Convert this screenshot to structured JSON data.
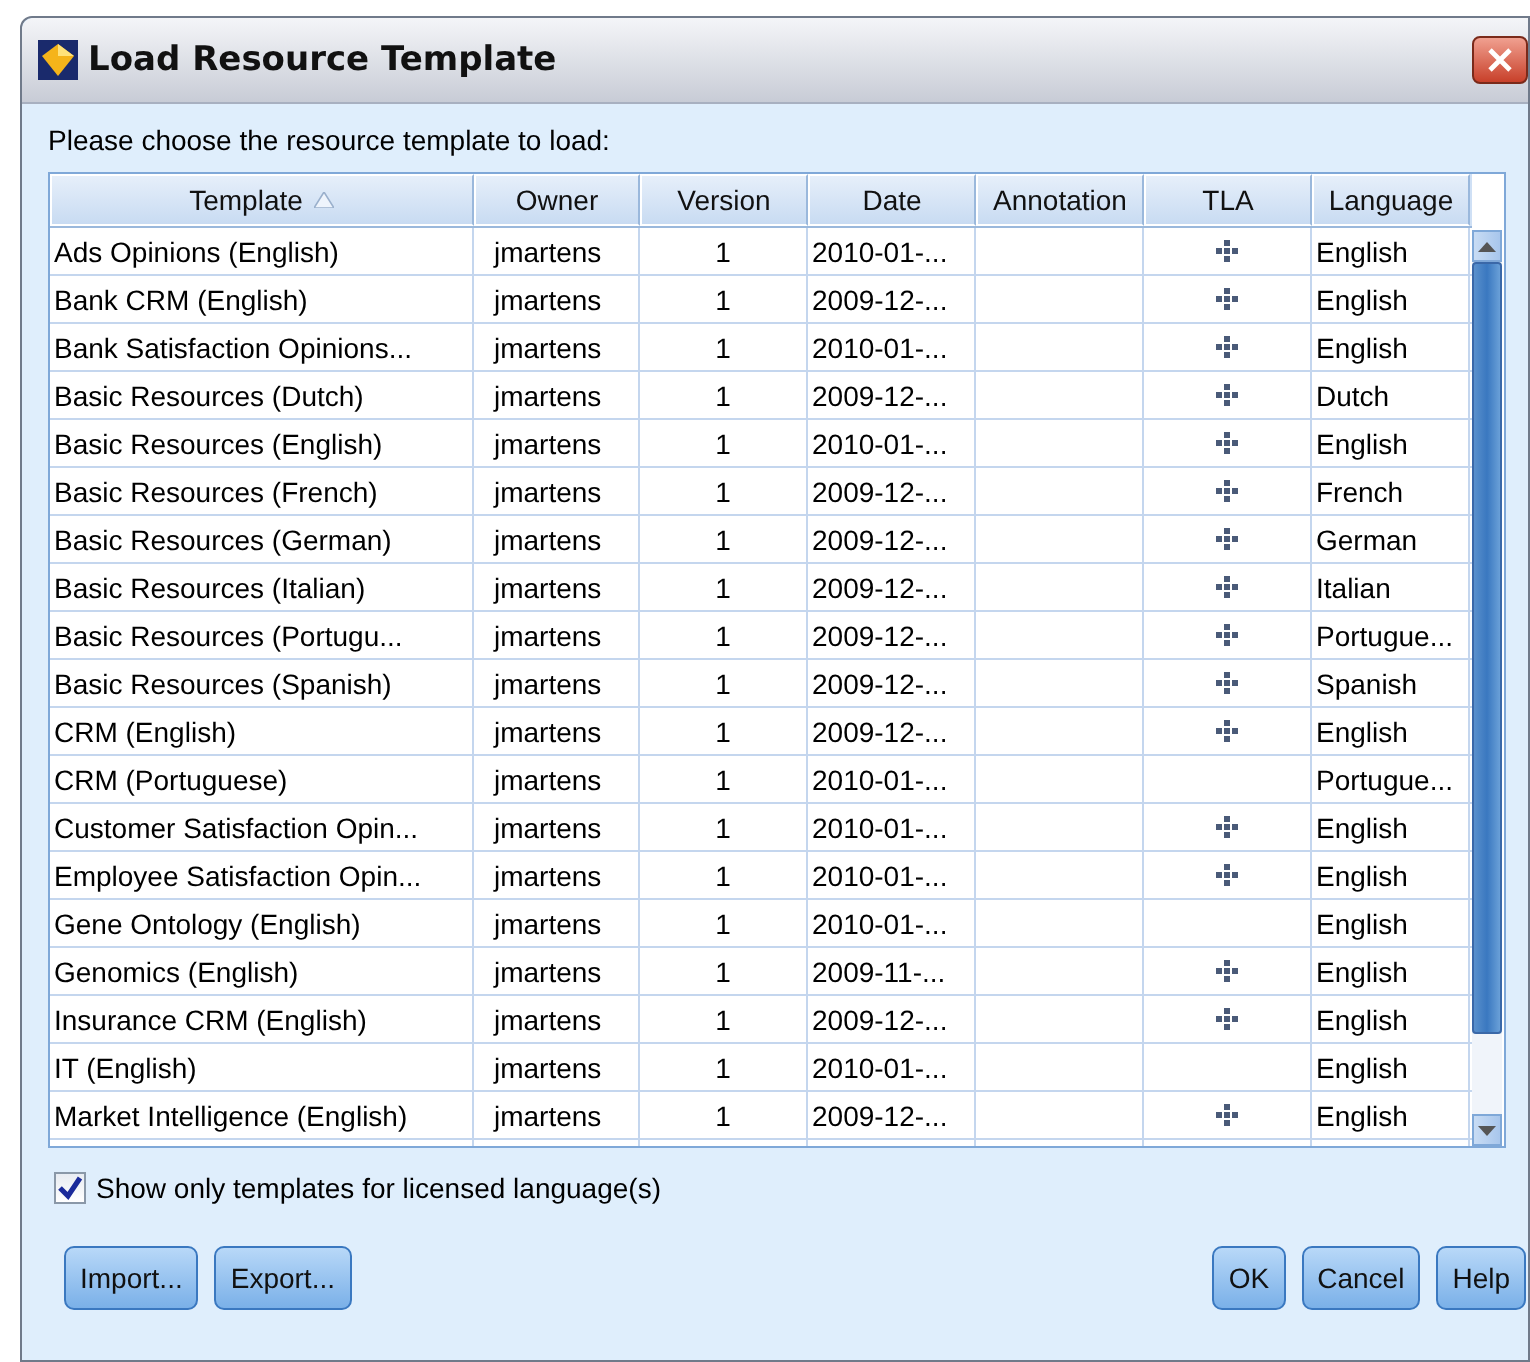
{
  "window": {
    "title": "Load Resource Template"
  },
  "prompt": "Please choose the resource template to load:",
  "table": {
    "columns": [
      {
        "label": "Template",
        "sorted": true
      },
      {
        "label": "Owner",
        "sorted": false
      },
      {
        "label": "Version",
        "sorted": false
      },
      {
        "label": "Date",
        "sorted": false
      },
      {
        "label": "Annotation",
        "sorted": false
      },
      {
        "label": "TLA",
        "sorted": false
      },
      {
        "label": "Language",
        "sorted": false
      }
    ],
    "rows": [
      {
        "template": "Ads Opinions (English)",
        "owner": "jmartens",
        "version": "1",
        "date": "2010-01-...",
        "tla": true,
        "language": "English"
      },
      {
        "template": "Bank CRM (English)",
        "owner": "jmartens",
        "version": "1",
        "date": "2009-12-...",
        "tla": true,
        "language": "English"
      },
      {
        "template": "Bank Satisfaction Opinions...",
        "owner": "jmartens",
        "version": "1",
        "date": "2010-01-...",
        "tla": true,
        "language": "English"
      },
      {
        "template": "Basic Resources (Dutch)",
        "owner": "jmartens",
        "version": "1",
        "date": "2009-12-...",
        "tla": true,
        "language": "Dutch"
      },
      {
        "template": "Basic Resources (English)",
        "owner": "jmartens",
        "version": "1",
        "date": "2010-01-...",
        "tla": true,
        "language": "English"
      },
      {
        "template": "Basic Resources (French)",
        "owner": "jmartens",
        "version": "1",
        "date": "2009-12-...",
        "tla": true,
        "language": "French"
      },
      {
        "template": "Basic Resources (German)",
        "owner": "jmartens",
        "version": "1",
        "date": "2009-12-...",
        "tla": true,
        "language": "German"
      },
      {
        "template": "Basic Resources (Italian)",
        "owner": "jmartens",
        "version": "1",
        "date": "2009-12-...",
        "tla": true,
        "language": "Italian"
      },
      {
        "template": "Basic Resources (Portugu...",
        "owner": "jmartens",
        "version": "1",
        "date": "2009-12-...",
        "tla": true,
        "language": "Portugue..."
      },
      {
        "template": "Basic Resources (Spanish)",
        "owner": "jmartens",
        "version": "1",
        "date": "2009-12-...",
        "tla": true,
        "language": "Spanish"
      },
      {
        "template": "CRM (English)",
        "owner": "jmartens",
        "version": "1",
        "date": "2009-12-...",
        "tla": true,
        "language": "English"
      },
      {
        "template": "CRM (Portuguese)",
        "owner": "jmartens",
        "version": "1",
        "date": "2010-01-...",
        "tla": false,
        "language": "Portugue..."
      },
      {
        "template": "Customer Satisfaction Opin...",
        "owner": "jmartens",
        "version": "1",
        "date": "2010-01-...",
        "tla": true,
        "language": "English"
      },
      {
        "template": "Employee Satisfaction Opin...",
        "owner": "jmartens",
        "version": "1",
        "date": "2010-01-...",
        "tla": true,
        "language": "English"
      },
      {
        "template": "Gene Ontology (English)",
        "owner": "jmartens",
        "version": "1",
        "date": "2010-01-...",
        "tla": false,
        "language": "English"
      },
      {
        "template": "Genomics (English)",
        "owner": "jmartens",
        "version": "1",
        "date": "2009-11-...",
        "tla": true,
        "language": "English"
      },
      {
        "template": "Insurance CRM (English)",
        "owner": "jmartens",
        "version": "1",
        "date": "2009-12-...",
        "tla": true,
        "language": "English"
      },
      {
        "template": "IT (English)",
        "owner": "jmartens",
        "version": "1",
        "date": "2010-01-...",
        "tla": false,
        "language": "English"
      },
      {
        "template": "Market Intelligence (English)",
        "owner": "jmartens",
        "version": "1",
        "date": "2009-12-...",
        "tla": true,
        "language": "English"
      }
    ]
  },
  "licensed_only": {
    "label": "Show only templates for licensed language(s)",
    "checked": true
  },
  "left_buttons": [
    "Import...",
    "Export..."
  ],
  "right_buttons": [
    "OK",
    "Cancel",
    "Help"
  ]
}
